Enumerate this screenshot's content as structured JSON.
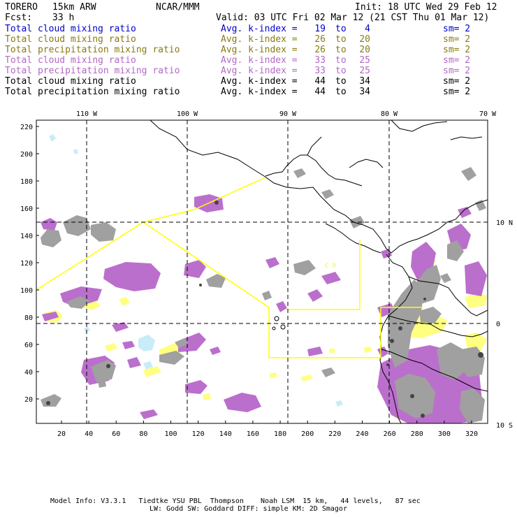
{
  "header": {
    "model": "TORERO",
    "resolution": "15km ARW",
    "center": "NCAR/MMM",
    "init": "Init: 18 UTC Wed 29 Feb 12",
    "fcst_label": "Fcst:",
    "fcst_value": "33 h",
    "valid": "Valid: 03 UTC Fri 02 Mar 12 (21 CST Thu 01 Mar 12)"
  },
  "legend": [
    {
      "name": "Total cloud mixing ratio",
      "k_label": "Avg. k-index =",
      "k_from": "19",
      "to": "to",
      "k_to": "4",
      "sm": "sm= 2",
      "color": "#0000cc"
    },
    {
      "name": "Total cloud mixing ratio",
      "k_label": "Avg. k-index =",
      "k_from": "26",
      "to": "to",
      "k_to": "20",
      "sm": "sm= 2",
      "color": "#8a7a10"
    },
    {
      "name": "Total precipitation mixing ratio",
      "k_label": "Avg. k-index =",
      "k_from": "26",
      "to": "to",
      "k_to": "20",
      "sm": "sm= 2",
      "color": "#8a7a10"
    },
    {
      "name": "Total cloud mixing ratio",
      "k_label": "Avg. k-index =",
      "k_from": "33",
      "to": "to",
      "k_to": "25",
      "sm": "sm= 2",
      "color": "#b368c4"
    },
    {
      "name": "Total precipitation mixing ratio",
      "k_label": "Avg. k-index =",
      "k_from": "33",
      "to": "to",
      "k_to": "25",
      "sm": "sm= 2",
      "color": "#b368c4"
    },
    {
      "name": "Total cloud mixing ratio",
      "k_label": "Avg. k-index =",
      "k_from": "44",
      "to": "to",
      "k_to": "34",
      "sm": "sm= 2",
      "color": "#000000"
    },
    {
      "name": "Total precipitation mixing ratio",
      "k_label": "Avg. k-index =",
      "k_from": "44",
      "to": "to",
      "k_to": "34",
      "sm": "sm= 2",
      "color": "#000000"
    }
  ],
  "axes": {
    "top_lon": [
      "110 W",
      "100 W",
      "90 W",
      "80 W",
      "70 W"
    ],
    "right_lat": [
      "10 N",
      "0",
      "10 S"
    ],
    "left_y": [
      "220",
      "200",
      "180",
      "160",
      "140",
      "120",
      "100",
      "80",
      "60",
      "40",
      "20"
    ],
    "bottom_x": [
      "20",
      "40",
      "60",
      "80",
      "100",
      "120",
      "140",
      "160",
      "180",
      "200",
      "220",
      "240",
      "260",
      "280",
      "300",
      "320"
    ]
  },
  "map_labels": [
    "C R"
  ],
  "footer": {
    "line1": "Model Info: V3.3.1   Tiedtke YSU PBL  Thompson    Noah LSM  15 km,   44 levels,   87 sec",
    "line2": "LW: Godd SW: Goddard DIFF: simple KM: 2D Smagor"
  },
  "colors": {
    "light_blue": "#c8ecf8",
    "yellow": "#ffff80",
    "purple": "#bb6fcc",
    "gray": "#a0a0a0",
    "dark_gray": "#555555",
    "domain_box": "#ffff00"
  }
}
